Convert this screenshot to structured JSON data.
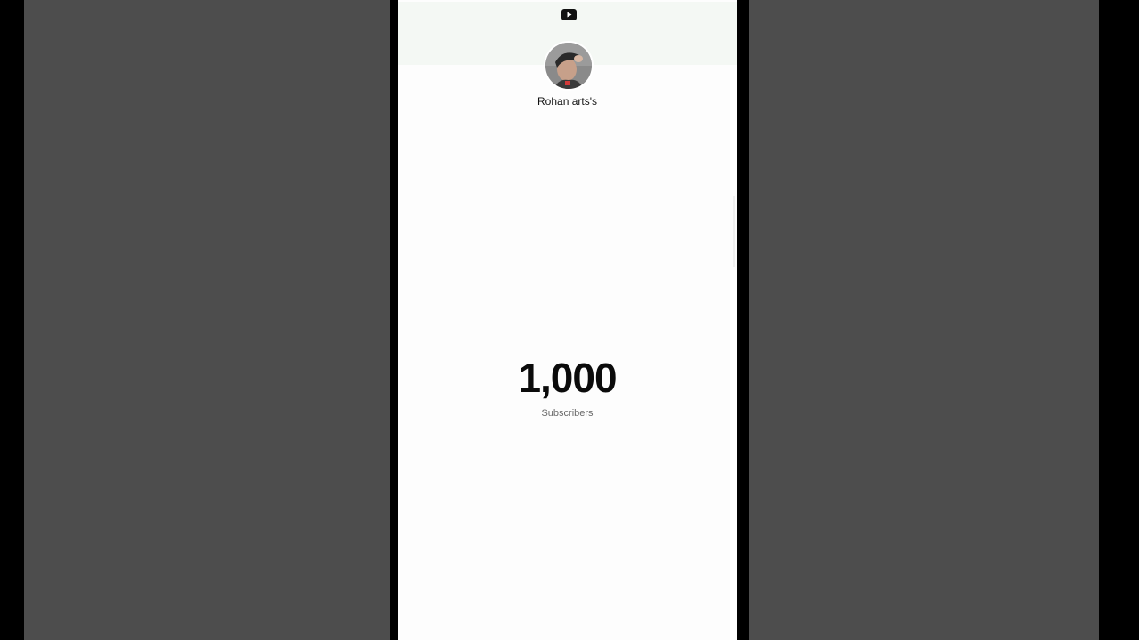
{
  "header": {
    "logo_icon": "youtube-play-icon"
  },
  "channel": {
    "name": "Rohan arts's",
    "avatar_icon": "channel-avatar"
  },
  "stats": {
    "subscriber_count": "1,000",
    "subscriber_label": "Subscribers"
  },
  "colors": {
    "background_blur": "#4d4d4d",
    "screen_bg": "#fdfdfd",
    "header_band": "#f4f8f4",
    "count_text": "#0b0b0b",
    "label_text": "#6a6a6a"
  }
}
